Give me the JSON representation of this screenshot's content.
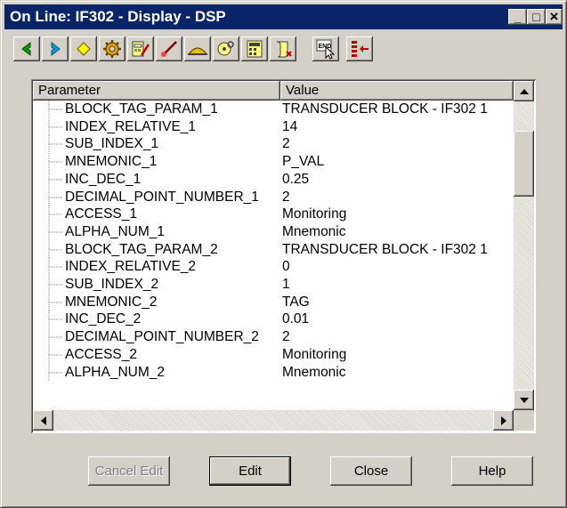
{
  "window": {
    "title": "On Line: IF302 - Display - DSP",
    "controls": {
      "minimize": "_",
      "maximize": "□",
      "close": "×"
    }
  },
  "toolbar": {
    "buttons": [
      {
        "icon": "left-arrow-icon"
      },
      {
        "icon": "right-arrow-icon"
      },
      {
        "icon": "diamond-icon"
      },
      {
        "icon": "gear-icon"
      },
      {
        "icon": "edit-device-icon"
      },
      {
        "icon": "check-icon"
      },
      {
        "icon": "cap-icon"
      },
      {
        "icon": "disk-magnifier-icon"
      },
      {
        "icon": "calculator-icon"
      },
      {
        "icon": "scroll-icon"
      },
      {
        "icon": "end-cursor-icon",
        "label": "END"
      },
      {
        "icon": "list-arrow-icon"
      }
    ]
  },
  "list": {
    "columns": [
      "Parameter",
      "Value"
    ],
    "rows": [
      {
        "name": "BLOCK_TAG_PARAM_1",
        "value": "TRANSDUCER BLOCK - IF302  1"
      },
      {
        "name": "INDEX_RELATIVE_1",
        "value": "14"
      },
      {
        "name": "SUB_INDEX_1",
        "value": "2"
      },
      {
        "name": "MNEMONIC_1",
        "value": "P_VAL"
      },
      {
        "name": "INC_DEC_1",
        "value": "0.25"
      },
      {
        "name": "DECIMAL_POINT_NUMBER_1",
        "value": "2"
      },
      {
        "name": "ACCESS_1",
        "value": "Monitoring"
      },
      {
        "name": "ALPHA_NUM_1",
        "value": "Mnemonic"
      },
      {
        "name": "BLOCK_TAG_PARAM_2",
        "value": "TRANSDUCER BLOCK - IF302  1"
      },
      {
        "name": "INDEX_RELATIVE_2",
        "value": "0"
      },
      {
        "name": "SUB_INDEX_2",
        "value": "1"
      },
      {
        "name": "MNEMONIC_2",
        "value": "TAG"
      },
      {
        "name": "INC_DEC_2",
        "value": "0.01"
      },
      {
        "name": "DECIMAL_POINT_NUMBER_2",
        "value": "2"
      },
      {
        "name": "ACCESS_2",
        "value": "Monitoring"
      },
      {
        "name": "ALPHA_NUM_2",
        "value": "Mnemonic"
      }
    ]
  },
  "buttons": {
    "cancel_edit": "Cancel Edit",
    "edit": "Edit",
    "close": "Close",
    "help": "Help"
  },
  "colors": {
    "titlebar": "#0a246a",
    "face": "#d4d0c8"
  }
}
